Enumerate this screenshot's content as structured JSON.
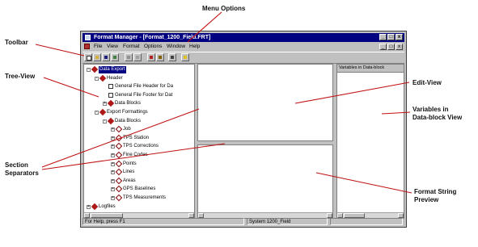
{
  "callouts": {
    "menu_options": "Menu Options",
    "toolbar": "Toolbar",
    "tree_view": "Tree-View",
    "edit_view": "Edit-View",
    "variables_line1": "Variables in",
    "variables_line2": "Data-block View",
    "section_line1": "Section",
    "section_line2": "Separators",
    "format_line1": "Format String",
    "format_line2": "Preview"
  },
  "window": {
    "title": "Format Manager - [Format_1200_Field.FRT]",
    "controls": [
      "_",
      "□",
      "x"
    ]
  },
  "menu": [
    "File",
    "View",
    "Format",
    "Options",
    "Window",
    "Help"
  ],
  "toolbar_icons": [
    "new-icon",
    "open-icon",
    "save-icon",
    "export-icon",
    "cut-icon",
    "copy-icon",
    "find-icon",
    "tree-icon",
    "split-icon",
    "help-icon"
  ],
  "tree": [
    {
      "text": "Data Export",
      "level": 0,
      "icon": "red",
      "exp": "-",
      "selected": true
    },
    {
      "text": "Header",
      "level": 1,
      "icon": "red",
      "exp": "-"
    },
    {
      "text": "General File Header for Da",
      "level": 2,
      "icon": "doc"
    },
    {
      "text": "General File Footer for Dat",
      "level": 2,
      "icon": "doc"
    },
    {
      "text": "Data Blocks",
      "level": 2,
      "icon": "red",
      "exp": "+"
    },
    {
      "text": "Export Formattings",
      "level": 1,
      "icon": "red",
      "exp": "-"
    },
    {
      "text": "Data Blocks",
      "level": 2,
      "icon": "red",
      "exp": "-"
    },
    {
      "text": "Job",
      "level": 3,
      "icon": "dia",
      "exp": "+"
    },
    {
      "text": "TPS Station",
      "level": 3,
      "icon": "dia",
      "exp": "+"
    },
    {
      "text": "TPS Corrections",
      "level": 3,
      "icon": "dia",
      "exp": "+"
    },
    {
      "text": "Fine Codes",
      "level": 3,
      "icon": "dia",
      "exp": "+"
    },
    {
      "text": "Points",
      "level": 3,
      "icon": "dia",
      "exp": "+"
    },
    {
      "text": "Lines",
      "level": 3,
      "icon": "dia",
      "exp": "+"
    },
    {
      "text": "Areas",
      "level": 3,
      "icon": "dia",
      "exp": "+"
    },
    {
      "text": "GPS Baselines",
      "level": 3,
      "icon": "dia",
      "exp": "+"
    },
    {
      "text": "TPS Measurements",
      "level": 3,
      "icon": "dia",
      "exp": "+"
    },
    {
      "text": "Logfiles",
      "level": 0,
      "icon": "red",
      "exp": "+"
    }
  ],
  "variables_header": "Variables in Data-block",
  "status": {
    "help": "For Help, press F1",
    "system": "System 1200_Field"
  }
}
